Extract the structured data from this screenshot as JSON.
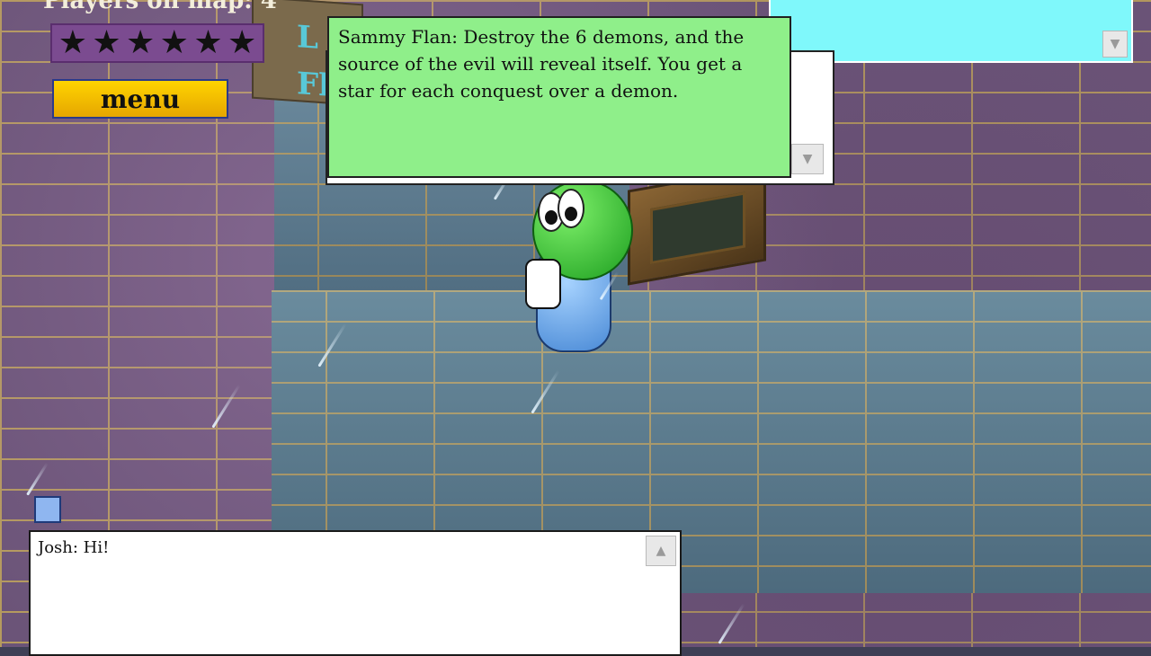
{
  "hud": {
    "players_label": "Players on map: 4",
    "stars_total": 6,
    "stars_earned": 0,
    "menu_label": "menu"
  },
  "sign": {
    "line1": "L",
    "line2": "Fl"
  },
  "npc_dialog": {
    "text": "Sammy Flan: Destroy the 6 demons, and the source of the evil will reveal itself. You get a star for each conquest over a demon."
  },
  "chat": {
    "text": "Josh: Hi!"
  },
  "scroll": {
    "up_glyph": "▲",
    "down_glyph": "▼"
  },
  "icons": {
    "star": "★"
  },
  "colors": {
    "npc_box": "#8fef8a",
    "top_right_panel": "#7ff8fb",
    "menu_button": "#ffd400",
    "star_box": "#7b4b90"
  }
}
